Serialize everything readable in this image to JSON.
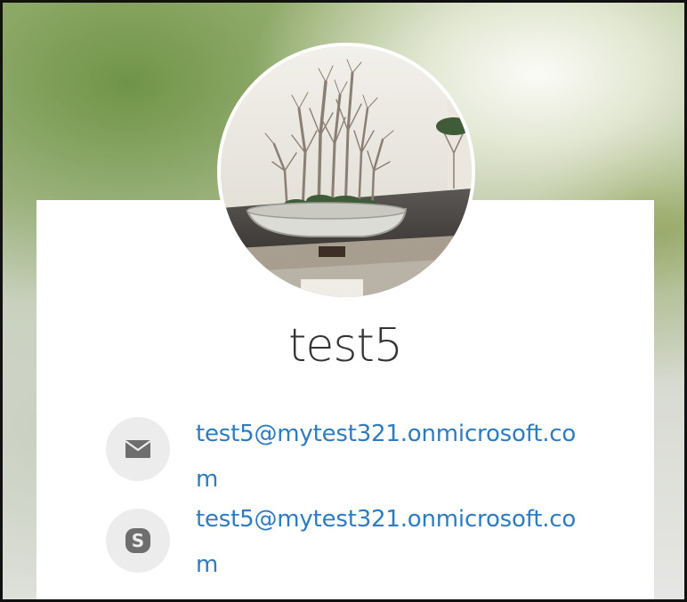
{
  "profile": {
    "name": "test5",
    "email": "test5@mytest321.onmicrosoft.com",
    "skype": "test5@mytest321.onmicrosoft.com"
  },
  "icons": {
    "email": "envelope-icon",
    "skype": "skype-icon"
  },
  "colors": {
    "link": "#2f7bbf",
    "icon_circle": "#ececec",
    "icon_glyph": "#6e6e6e",
    "name_text": "#333333"
  }
}
